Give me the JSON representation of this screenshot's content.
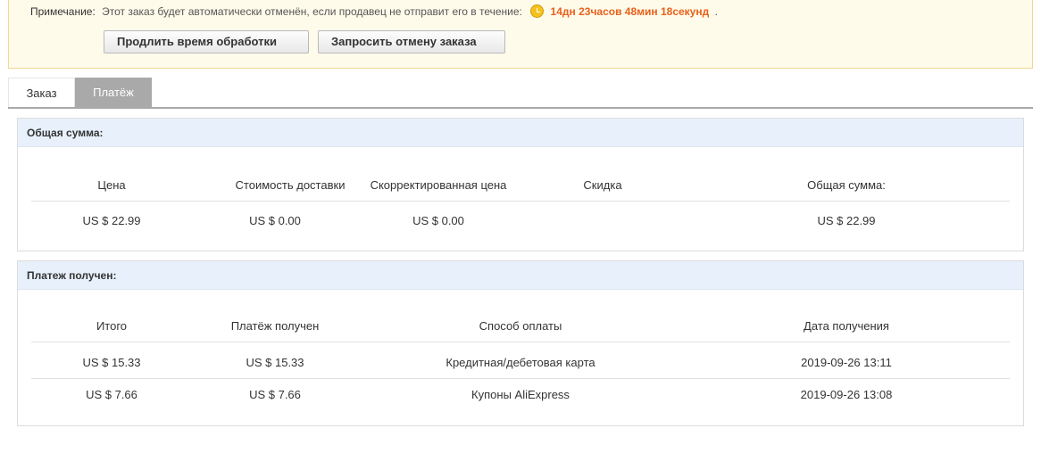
{
  "notice": {
    "label": "Примечание:",
    "text": "Этот заказ будет автоматически отменён, если продавец не отправит его в течение:",
    "timer": "14дн 23часов 48мин 18секунд",
    "tail": ".",
    "icon": "clock-icon"
  },
  "buttons": {
    "extend": "Продлить время обработки",
    "cancel": "Запросить отмену заказа"
  },
  "tabs": [
    {
      "label": "Заказ",
      "active": false
    },
    {
      "label": "Платёж",
      "active": true
    }
  ],
  "total": {
    "title": "Общая сумма:",
    "headers": [
      "Цена",
      "Стоимость доставки",
      "Скорректированная цена",
      "Скидка",
      "Общая сумма:"
    ],
    "values": [
      "US $ 22.99",
      "US $ 0.00",
      "US $ 0.00",
      "",
      "US $ 22.99"
    ]
  },
  "payment": {
    "title": "Платеж получен:",
    "headers": [
      "Итого",
      "Платёж получен",
      "Способ оплаты",
      "Дата получения"
    ],
    "rows": [
      [
        "US $ 15.33",
        "US $ 15.33",
        "Кредитная/дебетовая карта",
        "2019-09-26 13:11"
      ],
      [
        "US $ 7.66",
        "US $ 7.66",
        "Купоны AliExpress",
        "2019-09-26 13:08"
      ]
    ]
  },
  "colors": {
    "timer": "#e8611c",
    "panel_header_bg": "#e8f1fb",
    "active_tab_bg": "#a9a9a9",
    "notice_bg": "#fffbea"
  }
}
